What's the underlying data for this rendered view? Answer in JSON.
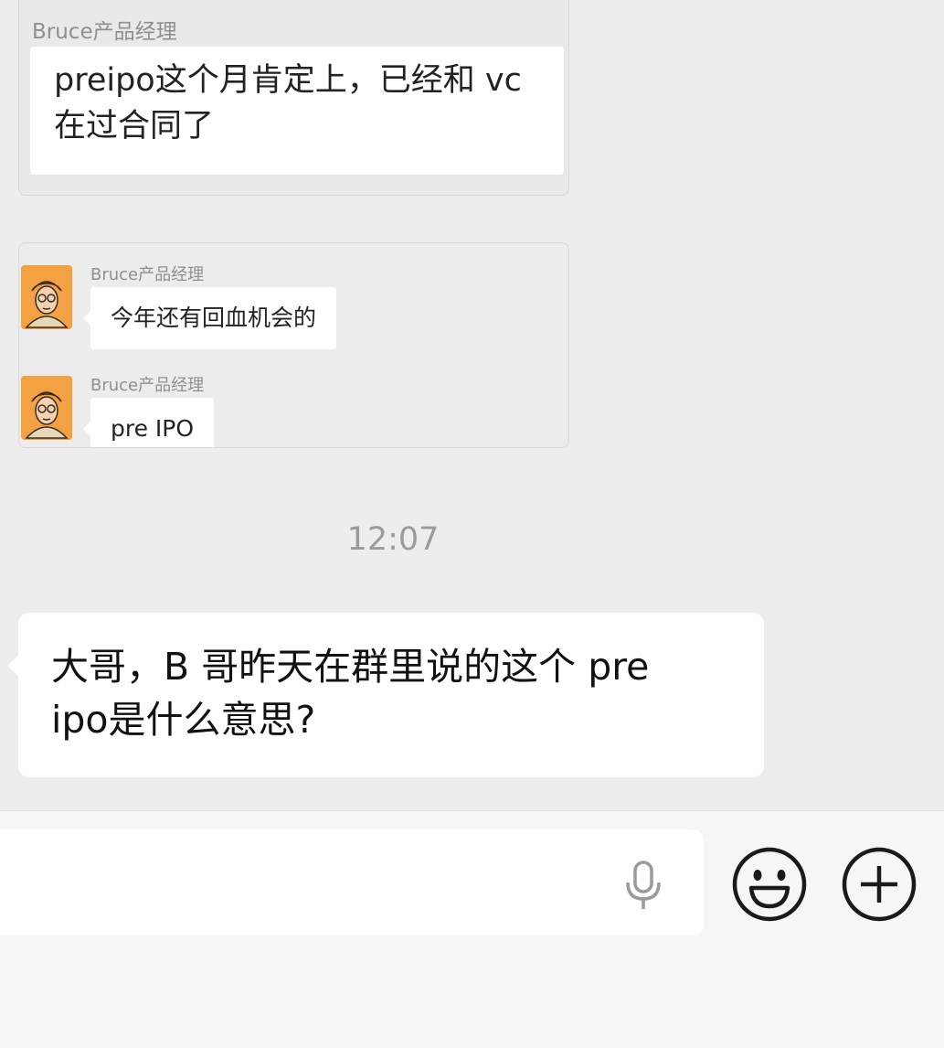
{
  "forwarded_screenshot_1": {
    "sender": "Bruce产品经理",
    "message_lines": [
      "preipo这个月肯定上，已经和 vc",
      "在过合同了"
    ]
  },
  "forwarded_screenshot_2": {
    "messages": [
      {
        "sender": "Bruce产品经理",
        "text": "今年还有回血机会的",
        "avatar_icon": "cartoon-man-avatar-icon"
      },
      {
        "sender": "Bruce产品经理",
        "text": "pre IPO",
        "avatar_icon": "cartoon-man-avatar-icon"
      }
    ]
  },
  "timestamp": "12:07",
  "incoming_message": {
    "lines": [
      "大哥，B 哥昨天在群里说的这个 pre",
      "ipo是什么意思?"
    ]
  },
  "input_bar": {
    "text_value": "",
    "icons": [
      "microphone-icon",
      "emoji-icon",
      "add-icon"
    ]
  },
  "colors": {
    "chat_background": "#ededed",
    "bubble": "#ffffff",
    "input_bar_background": "#f6f6f6",
    "timestamp": "#9b9b9b",
    "avatar_orange": "#f3a243"
  }
}
